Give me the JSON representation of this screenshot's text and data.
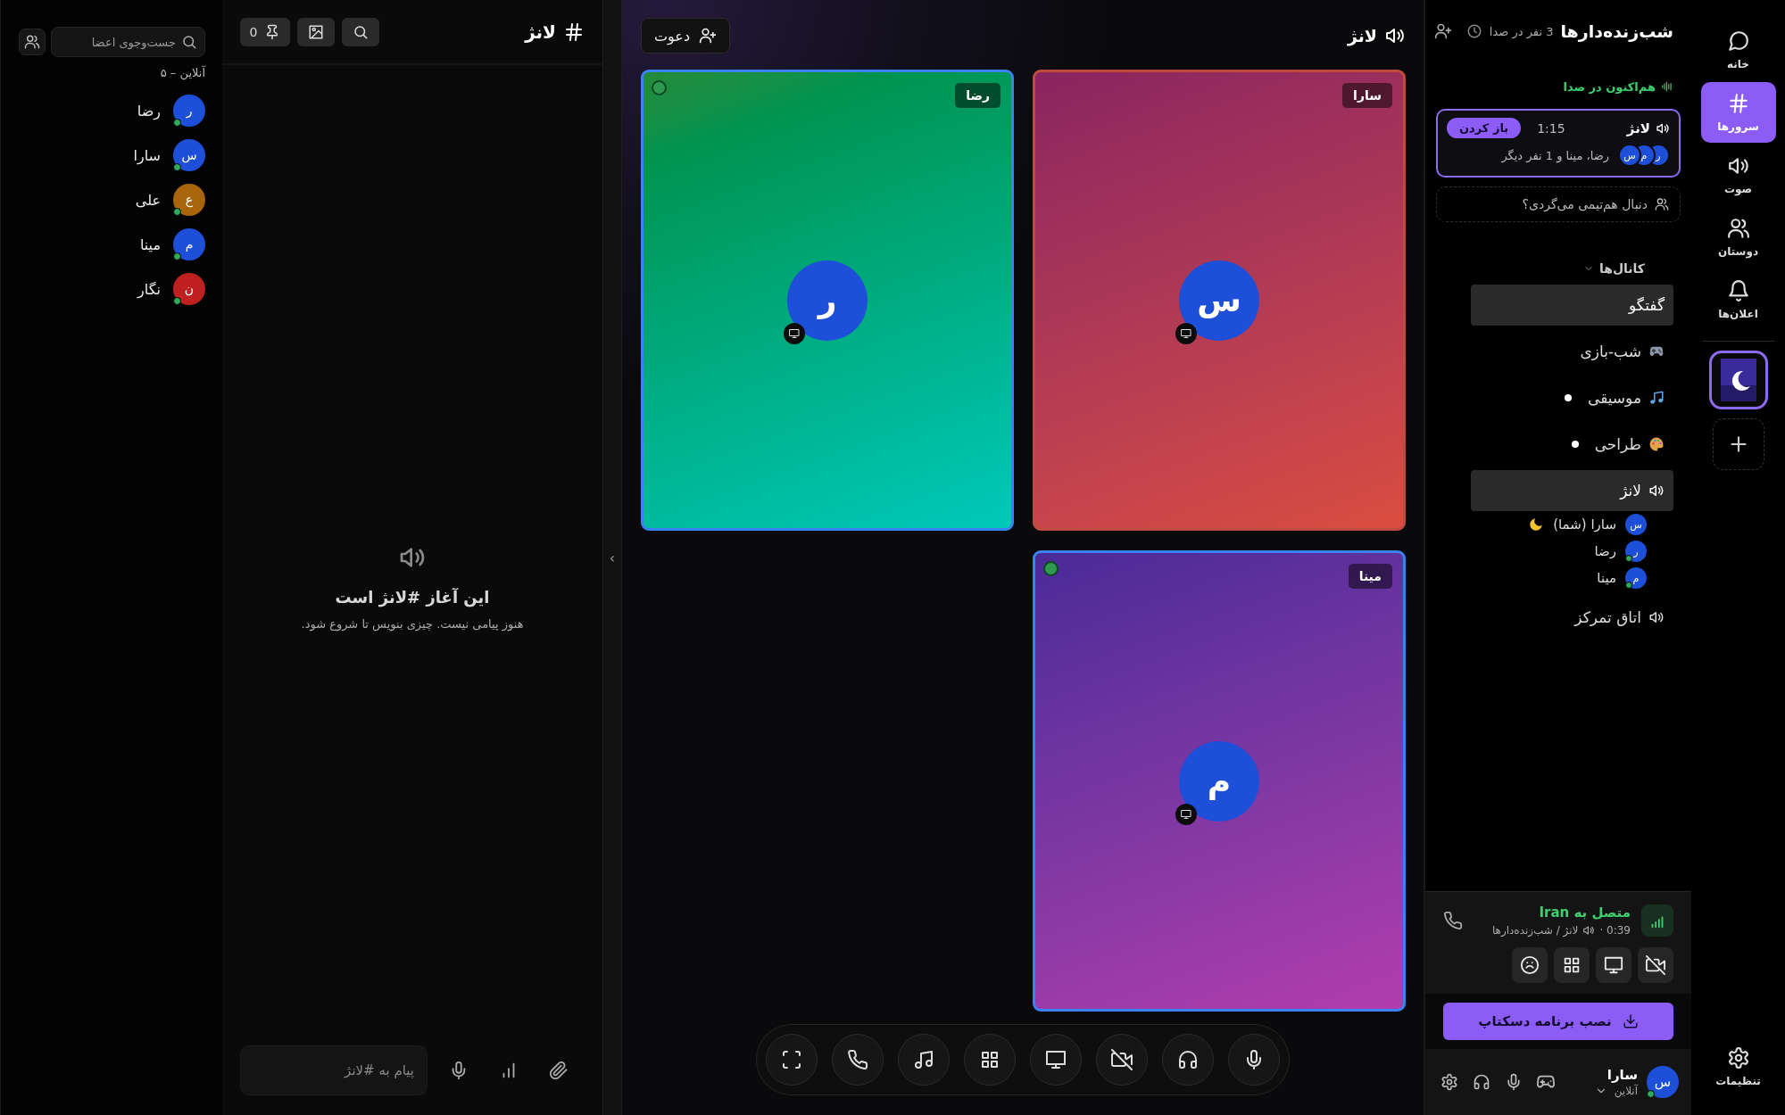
{
  "members": {
    "search_placeholder": "جست‌وجوی اعضا",
    "heading": "آنلاین – ۵",
    "items": [
      {
        "initial": "ر",
        "name": "رضا",
        "color": "#1d4fd8",
        "online": true
      },
      {
        "initial": "س",
        "name": "سارا",
        "color": "#1d4fd8",
        "online": true
      },
      {
        "initial": "ع",
        "name": "علی",
        "color": "#a8650c",
        "online": true
      },
      {
        "initial": "م",
        "name": "مینا",
        "color": "#1d4fd8",
        "online": true
      },
      {
        "initial": "ن",
        "name": "نگار",
        "color": "#c02020",
        "online": true
      }
    ]
  },
  "chat": {
    "channel": "لانژ",
    "pins": "0",
    "empty_title": "این آغاز #لانژ است",
    "empty_text": "هنوز پیامی نیست. چیزی بنویس تا شروع شود.",
    "input_placeholder": "پیام به #لانژ"
  },
  "collapse_handle": "‹",
  "stage": {
    "title": "لانژ",
    "invite": "دعوت",
    "tiles": [
      {
        "name": "سارا",
        "initial": "س",
        "color": "#8a2460",
        "speaking": false
      },
      {
        "name": "رضا",
        "initial": "ر",
        "color": "#238a3a",
        "speaking": true
      },
      {
        "name": "مینا",
        "initial": "م",
        "color": "#4a2a98",
        "speaking": true
      }
    ]
  },
  "sidebar": {
    "title": "شب‌زنده‌دارها",
    "in_voice_count": "3 نفر در صدا",
    "now_in_voice": "هم‌اکنون در صدا",
    "voice_card": {
      "channel": "لانژ",
      "duration": "1:15",
      "open": "باز کردن",
      "avatars": [
        "ر",
        "م",
        "س"
      ],
      "summary": "رضا، مینا و 1 نفر دیگر"
    },
    "teammate_prompt": "دنبال هم‌تیمی می‌گردی؟",
    "channels": {
      "heading": "کانال‌ها",
      "expanded": true,
      "items": [
        {
          "kind": "text",
          "name": "گفتگو",
          "selected": true,
          "unread": false
        },
        {
          "kind": "game",
          "name": "شب-بازی",
          "selected": false,
          "unread": false
        },
        {
          "kind": "music",
          "name": "موسیقی",
          "selected": false,
          "unread": true
        },
        {
          "kind": "art",
          "name": "طراحی",
          "selected": false,
          "unread": true
        },
        {
          "kind": "voice",
          "name": "لانژ",
          "selected": true,
          "unread": false,
          "members": [
            {
              "initial": "س",
              "name": "سارا (شما)",
              "online": false,
              "idle": true
            },
            {
              "initial": "ر",
              "name": "رضا",
              "online": true,
              "idle": false
            },
            {
              "initial": "م",
              "name": "مینا",
              "online": true,
              "idle": false
            }
          ]
        },
        {
          "kind": "voice",
          "name": "اتاق تمرکز",
          "selected": false,
          "unread": false
        }
      ]
    },
    "connection": {
      "status": "متصل به Iran",
      "elapsed": "0:39 ·",
      "path": "لانژ / شب‌زنده‌دارها"
    },
    "install": "نصب برنامه دسکتاپ",
    "user": {
      "initial": "س",
      "name": "سارا",
      "status": "آنلاین",
      "online": true
    }
  },
  "nav": {
    "items": [
      {
        "kind": "chat",
        "label": "خانه",
        "selected": false
      },
      {
        "kind": "hash",
        "label": "سرورها",
        "selected": true
      },
      {
        "kind": "speaker",
        "label": "صوت",
        "selected": false
      },
      {
        "kind": "friends",
        "label": "دوستان",
        "selected": false
      },
      {
        "kind": "bell",
        "label": "اعلان‌ها",
        "selected": false
      }
    ],
    "server_selected": true,
    "settings": "تنظیمات"
  }
}
